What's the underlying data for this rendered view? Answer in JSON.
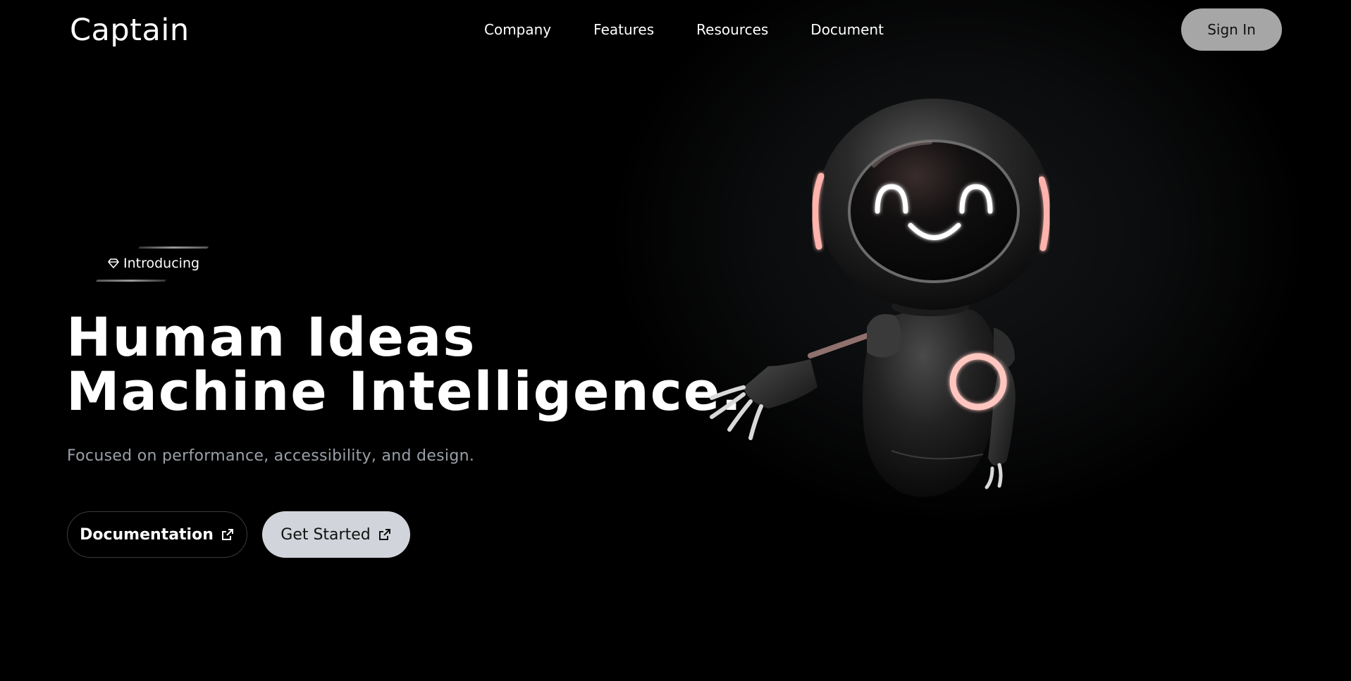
{
  "header": {
    "logo": "Captain",
    "nav": [
      "Company",
      "Features",
      "Resources",
      "Document"
    ],
    "signin_label": "Sign In"
  },
  "badge": {
    "icon": "gem-icon",
    "label": "Introducing"
  },
  "hero": {
    "title_line1": "Human Ideas",
    "title_line2": "Machine Intelligence.",
    "subtitle": "Focused on performance, accessibility, and design."
  },
  "actions": {
    "documentation_label": "Documentation",
    "get_started_label": "Get Started",
    "icon": "external-link-icon"
  },
  "illustration": {
    "name": "robot-mascot",
    "accent_color": "#ffb3ad"
  }
}
